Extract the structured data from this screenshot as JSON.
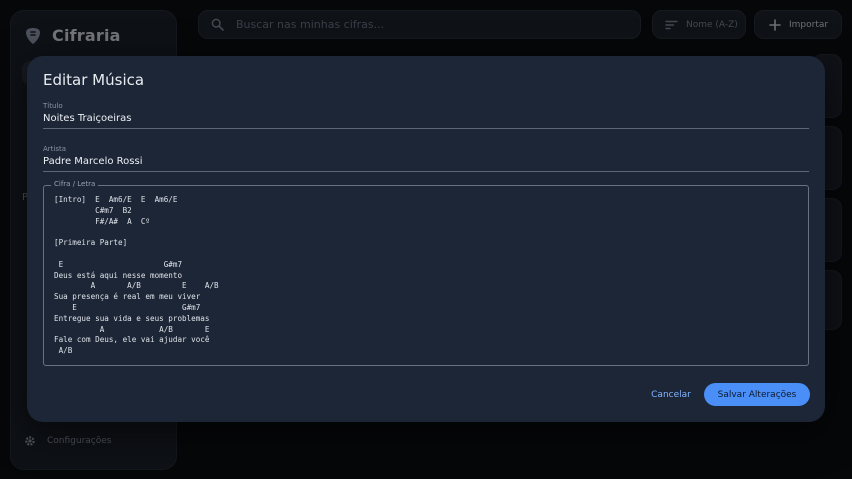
{
  "app": {
    "name": "Cifraria",
    "sidebar_letter": "P",
    "settings_label": "Configurações",
    "search_placeholder": "Buscar nas minhas cifras...",
    "sort_label": "Nome (A-Z)",
    "import_label": "Importar",
    "accent": "#4a8ef7"
  },
  "dialog": {
    "title": "Editar Música",
    "title_label": "Título",
    "title_value": "Noites Traiçoeiras",
    "artist_label": "Artista",
    "artist_value": "Padre Marcelo Rossi",
    "lyrics_label": "Cifra / Letra",
    "lyrics": "[Intro]  E  Am6/E  E  Am6/E\n         C#m7  B2\n         F#/A#  A  Cº\n\n[Primeira Parte]\n\n E                      G#m7\nDeus está aqui nesse momento\n        A       A/B         E    A/B\nSua presença é real em meu viver\n    E                       G#m7\nEntregue sua vida e seus problemas\n          A            A/B       E\nFale com Deus, ele vai ajudar você\n A/B",
    "cancel_label": "Cancelar",
    "save_label": "Salvar Alterações"
  },
  "icons": {
    "logo": "guitar-pick-icon",
    "search": "search-icon",
    "sort": "sort-icon",
    "import": "plus-icon",
    "settings": "gear-icon"
  }
}
